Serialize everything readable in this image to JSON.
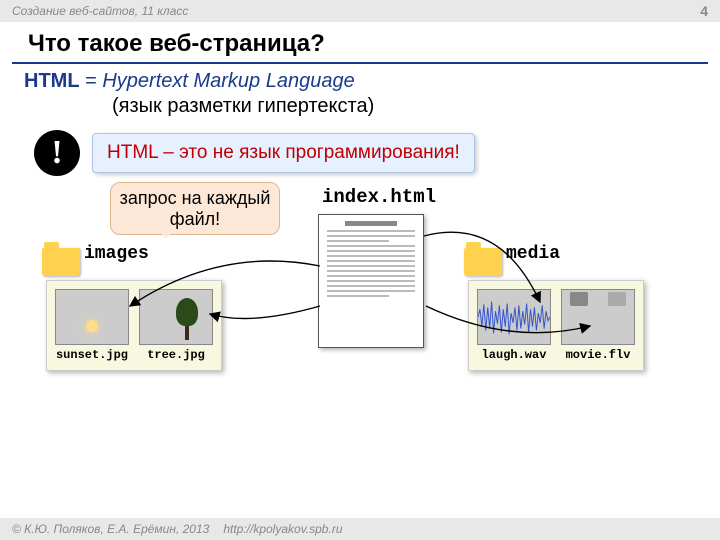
{
  "header": {
    "course": "Создание веб-сайтов, 11 класс",
    "pagenum": "4"
  },
  "title": "Что такое веб-страница?",
  "html_line": {
    "abbr": "HTML",
    "eq": " = ",
    "full": "Hypertext Markup Language"
  },
  "subtitle": "(язык разметки гипертекста)",
  "warning": {
    "mark": "!",
    "text": "HTML – это не язык программирования!"
  },
  "bubble": "запрос на каждый файл!",
  "index_file": "index.html",
  "folders": {
    "images": "images",
    "media": "media"
  },
  "thumbs": {
    "sunset": "sunset.jpg",
    "tree": "tree.jpg",
    "laugh": "laugh.wav",
    "movie": "movie.flv"
  },
  "footer": {
    "copyright": "© К.Ю. Поляков, Е.А. Ерёмин, 2013",
    "url": "http://kpolyakov.spb.ru"
  }
}
